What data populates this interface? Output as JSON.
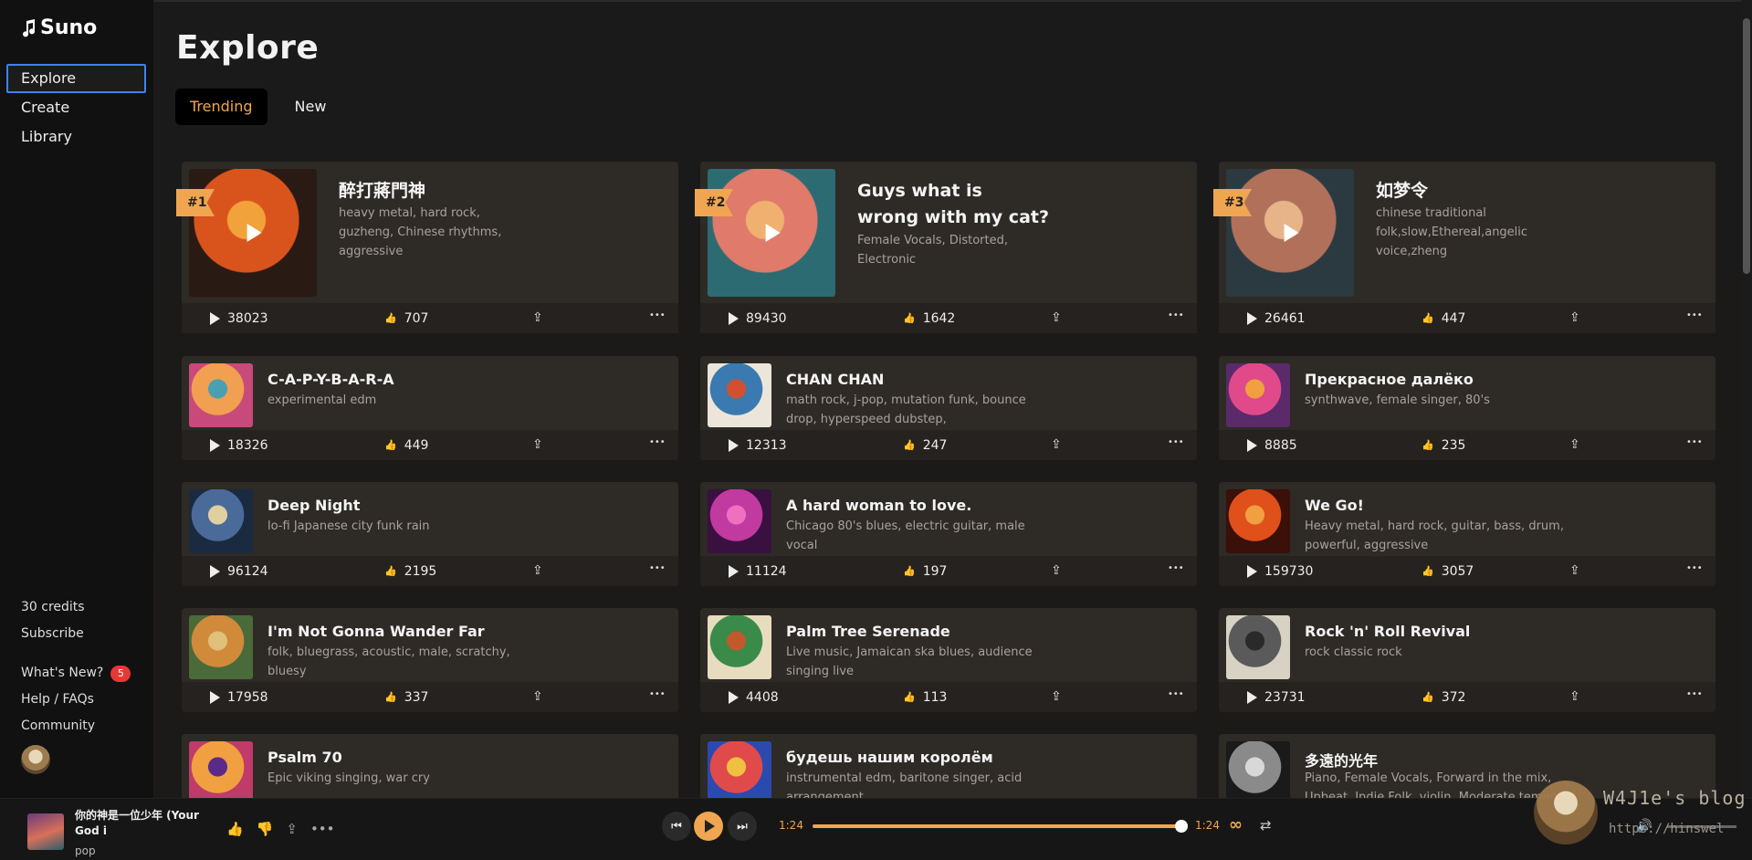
{
  "app": {
    "brand": "Suno"
  },
  "sidebar": {
    "nav": [
      {
        "label": "Explore",
        "active": true
      },
      {
        "label": "Create"
      },
      {
        "label": "Library"
      }
    ],
    "credits": "30 credits",
    "subscribe": "Subscribe",
    "whats_new": "What's New?",
    "whats_new_count": "5",
    "help": "Help / FAQs",
    "community": "Community"
  },
  "page": {
    "title": "Explore",
    "tabs": [
      {
        "label": "Trending",
        "active": true
      },
      {
        "label": "New"
      }
    ]
  },
  "featured": [
    {
      "rank": "#1",
      "title": "醉打蔣門神",
      "tags": "heavy metal, hard rock, guzheng, Chinese rhythms, aggressive",
      "plays": "38023",
      "likes": "707",
      "colors": [
        "#2a1a14",
        "#d9541c",
        "#f2a23a"
      ]
    },
    {
      "rank": "#2",
      "title": "Guys what is wrong with my cat?",
      "tags": "Female Vocals, Distorted, Electronic",
      "plays": "89430",
      "likes": "1642",
      "colors": [
        "#2d6b73",
        "#e07a6a",
        "#f0b070"
      ]
    },
    {
      "rank": "#3",
      "title": "如梦令",
      "tags": "chinese traditional folk,slow,Ethereal,angelic voice,zheng",
      "plays": "26461",
      "likes": "447",
      "colors": [
        "#2a3a40",
        "#b0705a",
        "#e7b48a"
      ]
    }
  ],
  "songs": [
    {
      "title": "C-A-P-Y-B-A-R-A",
      "tags": "experimental edm",
      "plays": "18326",
      "likes": "449",
      "colors": [
        "#c84a7a",
        "#f0a050",
        "#4aa0b0"
      ]
    },
    {
      "title": "CHAN CHAN",
      "tags": "math rock, j-pop, mutation funk, bounce drop, hyperspeed dubstep,",
      "plays": "12313",
      "likes": "247",
      "colors": [
        "#ece6da",
        "#3a7ab0",
        "#d05030"
      ]
    },
    {
      "title": "Прекрасное далёко",
      "tags": "synthwave, female singer, 80's",
      "plays": "8885",
      "likes": "235",
      "colors": [
        "#5a2a6a",
        "#e04a8a",
        "#f0a040"
      ]
    },
    {
      "title": "Deep Night",
      "tags": "lo-fi Japanese city funk rain",
      "plays": "96124",
      "likes": "2195",
      "colors": [
        "#1a2a40",
        "#4a6a9a",
        "#e0d0a0"
      ]
    },
    {
      "title": "A hard woman to love.",
      "tags": "Chicago 80's blues, electric guitar, male vocal",
      "plays": "11124",
      "likes": "197",
      "colors": [
        "#3a1040",
        "#c03aa0",
        "#f070c0"
      ]
    },
    {
      "title": "We Go!",
      "tags": "Heavy metal, hard rock, guitar, bass, drum, powerful, aggressive",
      "plays": "159730",
      "likes": "3057",
      "colors": [
        "#3a1008",
        "#e0501a",
        "#f0a040"
      ]
    },
    {
      "title": "I'm Not Gonna Wander Far",
      "tags": "folk, bluegrass, acoustic, male, scratchy, bluesy",
      "plays": "17958",
      "likes": "337",
      "colors": [
        "#4a6a3a",
        "#d08a3a",
        "#e0c07a"
      ]
    },
    {
      "title": "Palm Tree Serenade",
      "tags": "Live music, Jamaican ska blues, audience singing live",
      "plays": "4408",
      "likes": "113",
      "colors": [
        "#e8dcc0",
        "#3a8a4a",
        "#c05a2a"
      ]
    },
    {
      "title": "Rock 'n' Roll Revival",
      "tags": "rock classic rock",
      "plays": "23731",
      "likes": "372",
      "colors": [
        "#d8d2c4",
        "#5a5a5a",
        "#2a2a2a"
      ]
    },
    {
      "title": "Psalm 70",
      "tags": "Epic viking singing, war cry",
      "plays": "",
      "likes": "",
      "colors": [
        "#c03a6a",
        "#f0a040",
        "#5a2a8a"
      ]
    },
    {
      "title": "будешь нашим королём",
      "tags": "instrumental edm, baritone singer, acid arrangement",
      "plays": "",
      "likes": "",
      "colors": [
        "#2a4ab0",
        "#e04a4a",
        "#f0c040"
      ]
    },
    {
      "title": "多遠的光年",
      "tags": "Piano, Female Vocals, Forward in the mix, Upbeat, Indie Folk, violin, Moderate tempo",
      "plays": "",
      "likes": "",
      "colors": [
        "#1a1a1a",
        "#8a8a8a",
        "#d8d8d8"
      ]
    }
  ],
  "player": {
    "title": "你的神是一位少年 (Your God i",
    "genre": "pop",
    "time_current": "1:24",
    "time_total": "1:24",
    "progress": 1.0,
    "loop_symbol": "∞"
  },
  "watermark": {
    "text": "W4J1e's blog",
    "url": "https://hinswel"
  },
  "icons": {
    "play": "play-icon",
    "like": "thumbs-up-icon",
    "share": "share-icon",
    "more": "more-icon"
  },
  "accent": "#f0a550"
}
